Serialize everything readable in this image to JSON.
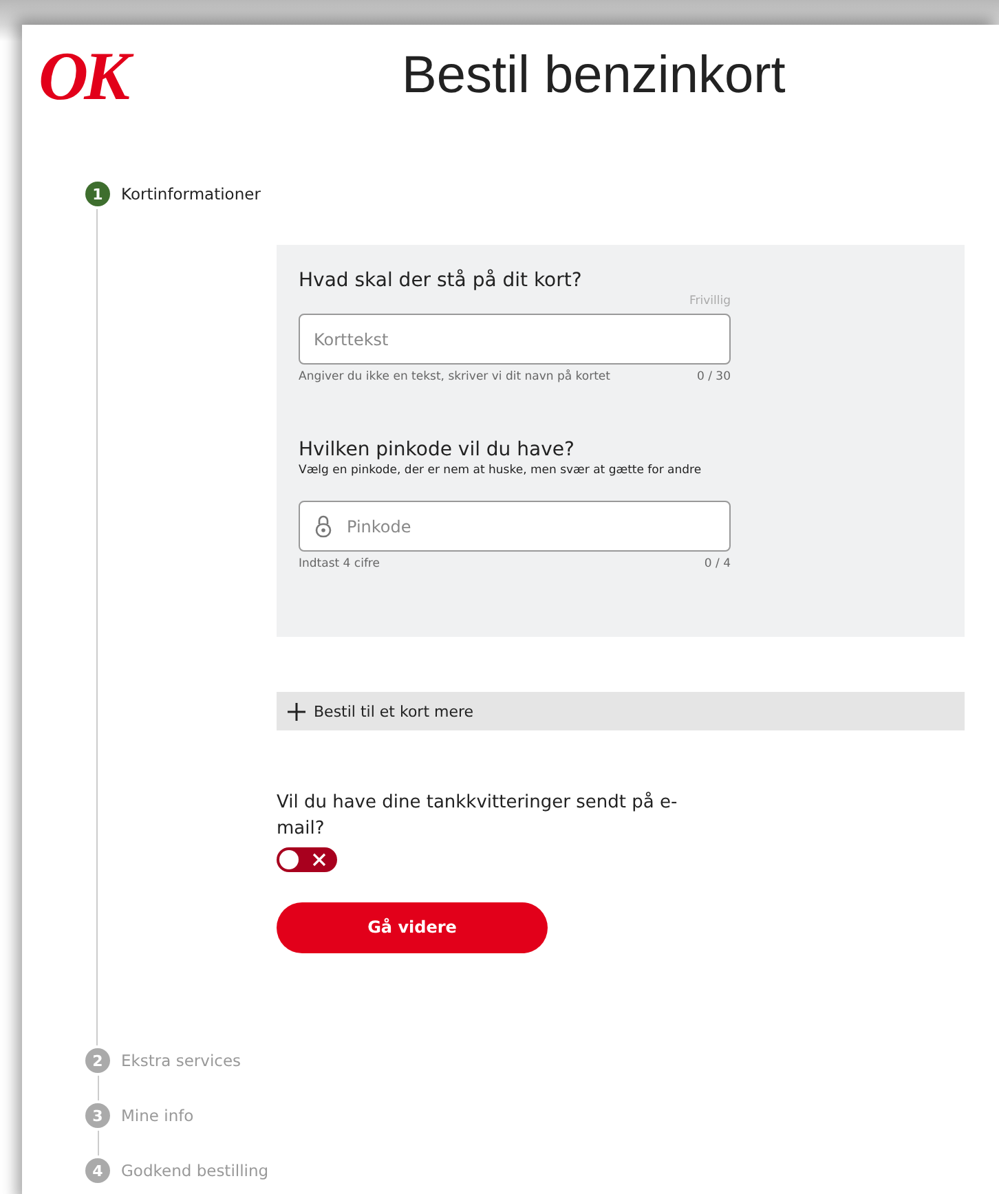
{
  "header": {
    "logo": "OK",
    "title": "Bestil benzinkort"
  },
  "steps": [
    {
      "number": "1",
      "label": "Kortinformationer",
      "selected": true
    },
    {
      "number": "2",
      "label": "Ekstra services",
      "selected": false
    },
    {
      "number": "3",
      "label": "Mine info",
      "selected": false
    },
    {
      "number": "4",
      "label": "Godkend bestilling",
      "selected": false
    }
  ],
  "card_form": {
    "card_text": {
      "heading": "Hvad skal der stå på dit kort?",
      "optional": "Frivillig",
      "placeholder": "Korttekst",
      "hint": "Angiver du ikke en tekst, skriver vi dit navn på kortet",
      "counter": "0 / 30"
    },
    "pin": {
      "heading": "Hvilken pinkode vil du have?",
      "description": "Vælg en pinkode, der er nem at huske, men svær at gætte for andre",
      "placeholder": "Pinkode",
      "hint": "Indtast 4 cifre",
      "counter": "0 / 4"
    }
  },
  "add_card": {
    "label": "Bestil til et kort mere"
  },
  "email_receipts": {
    "question": "Vil du have dine tankkvitteringer sendt på e-mail?",
    "on": false
  },
  "continue_button": "Gå videre"
}
